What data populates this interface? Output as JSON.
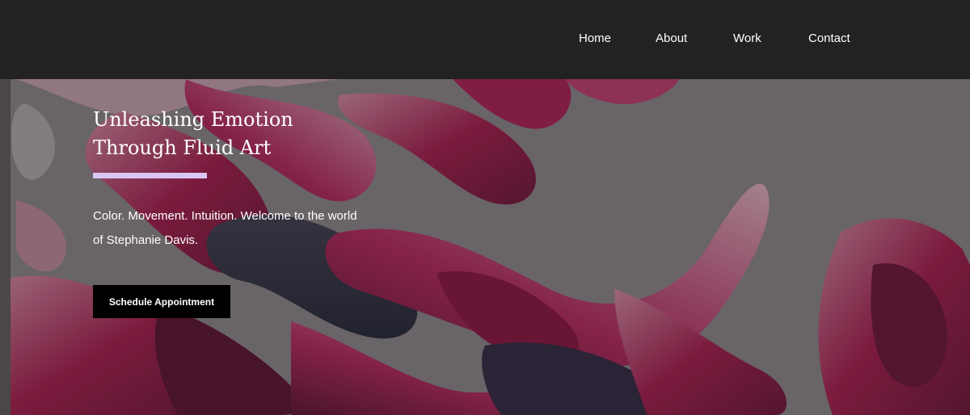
{
  "nav": {
    "items": [
      {
        "label": "Home"
      },
      {
        "label": "About"
      },
      {
        "label": "Work"
      },
      {
        "label": "Contact"
      }
    ]
  },
  "hero": {
    "headline": "Unleashing Emotion Through Fluid Art",
    "subtext": "Color. Movement. Intuition. Welcome to the world of Stephanie Davis.",
    "cta_label": "Schedule Appointment"
  },
  "colors": {
    "nav_bg": "#222222",
    "accent": "#d9c6f5",
    "cta_bg": "#000000",
    "paint_magenta": "#b01a55"
  }
}
